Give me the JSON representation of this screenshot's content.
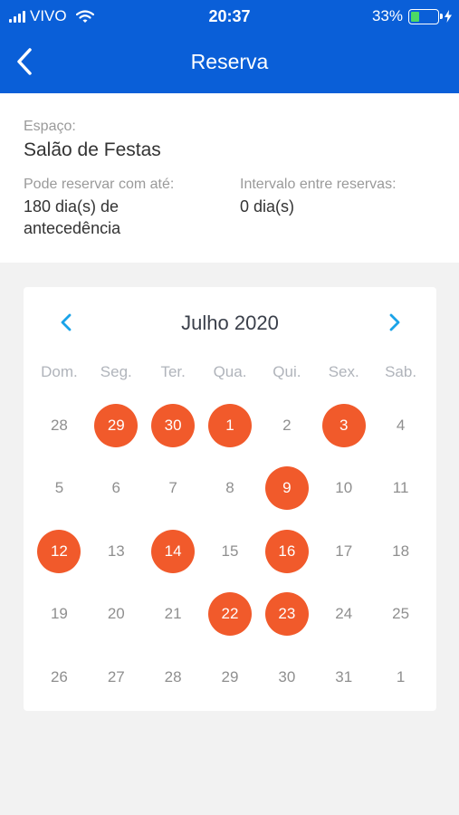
{
  "status": {
    "carrier": "VIVO",
    "time": "20:37",
    "battery": "33%",
    "battery_level": 0.33
  },
  "nav": {
    "title": "Reserva",
    "back_icon": "chevron-left-icon"
  },
  "info": {
    "space_label": "Espaço:",
    "space_value": "Salão de Festas",
    "advance_label": "Pode reservar com até:",
    "advance_value_line1": "180 dia(s) de",
    "advance_value_line2": "antecedência",
    "interval_label": "Intervalo entre reservas:",
    "interval_value": "0 dia(s)"
  },
  "calendar": {
    "month": "Julho 2020",
    "weekdays": [
      "Dom.",
      "Seg.",
      "Ter.",
      "Qua.",
      "Qui.",
      "Sex.",
      "Sab."
    ],
    "days": [
      {
        "d": "28",
        "r": false
      },
      {
        "d": "29",
        "r": true
      },
      {
        "d": "30",
        "r": true
      },
      {
        "d": "1",
        "r": true
      },
      {
        "d": "2",
        "r": false
      },
      {
        "d": "3",
        "r": true
      },
      {
        "d": "4",
        "r": false
      },
      {
        "d": "5",
        "r": false
      },
      {
        "d": "6",
        "r": false
      },
      {
        "d": "7",
        "r": false
      },
      {
        "d": "8",
        "r": false
      },
      {
        "d": "9",
        "r": true
      },
      {
        "d": "10",
        "r": false
      },
      {
        "d": "11",
        "r": false
      },
      {
        "d": "12",
        "r": true
      },
      {
        "d": "13",
        "r": false
      },
      {
        "d": "14",
        "r": true
      },
      {
        "d": "15",
        "r": false
      },
      {
        "d": "16",
        "r": true
      },
      {
        "d": "17",
        "r": false
      },
      {
        "d": "18",
        "r": false
      },
      {
        "d": "19",
        "r": false
      },
      {
        "d": "20",
        "r": false
      },
      {
        "d": "21",
        "r": false
      },
      {
        "d": "22",
        "r": true
      },
      {
        "d": "23",
        "r": true
      },
      {
        "d": "24",
        "r": false
      },
      {
        "d": "25",
        "r": false
      },
      {
        "d": "26",
        "r": false
      },
      {
        "d": "27",
        "r": false
      },
      {
        "d": "28",
        "r": false
      },
      {
        "d": "29",
        "r": false
      },
      {
        "d": "30",
        "r": false
      },
      {
        "d": "31",
        "r": false
      },
      {
        "d": "1",
        "r": false
      }
    ]
  },
  "colors": {
    "header": "#0a5fd8",
    "reserved": "#f15a2b",
    "arrows": "#1aa3e8"
  }
}
